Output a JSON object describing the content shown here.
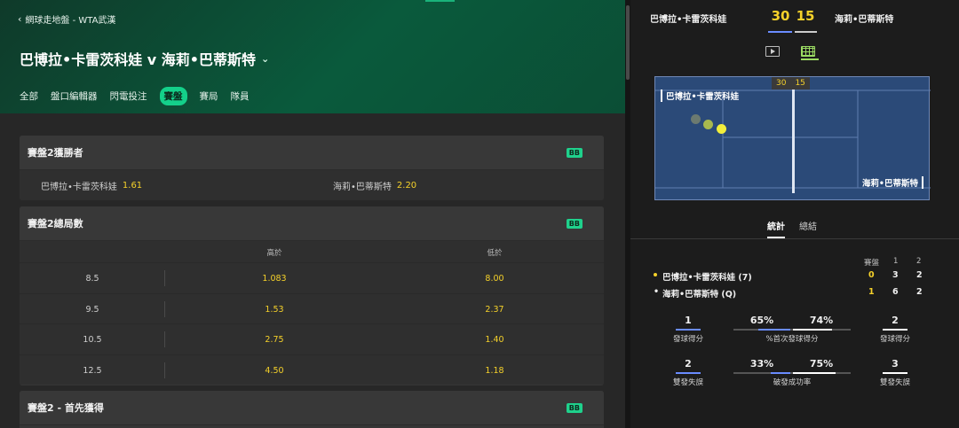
{
  "breadcrumb": {
    "back_label": "網球走地盤 - WTA武漢"
  },
  "match": {
    "title": "巴博拉•卡雷茨科娃 v 海莉•巴蒂斯特"
  },
  "nav_tabs": [
    "全部",
    "盤口編輯器",
    "閃電投注",
    "賽盤",
    "賽局",
    "隊員"
  ],
  "active_tab": "賽盤",
  "markets": [
    {
      "title": "賽盤2獲勝者",
      "badge": "BB",
      "selections": [
        {
          "name": "巴博拉•卡雷茨科娃",
          "odds": "1.61"
        },
        {
          "name": "海莉•巴蒂斯特",
          "odds": "2.20"
        }
      ]
    },
    {
      "title": "賽盤2總局數",
      "badge": "BB",
      "columns": [
        "高於",
        "低於"
      ],
      "rows": [
        {
          "line": "8.5",
          "over": "1.083",
          "under": "8.00"
        },
        {
          "line": "9.5",
          "over": "1.53",
          "under": "2.37"
        },
        {
          "line": "10.5",
          "over": "2.75",
          "under": "1.40"
        },
        {
          "line": "12.5",
          "over": "4.50",
          "under": "1.18"
        }
      ]
    },
    {
      "title": "賽盤2 - 首先獲得",
      "badge": "BB"
    }
  ],
  "scoreboard": {
    "player1": "巴博拉•卡雷茨科娃",
    "player2": "海莉•巴蒂斯特",
    "points1": "30",
    "points2": "15"
  },
  "court": {
    "score1": "30",
    "score2": "15",
    "player1": "巴博拉•卡雷茨科娃",
    "player2": "海莉•巴蒂斯特"
  },
  "stats_tabs": [
    "統計",
    "總結"
  ],
  "sets_table": {
    "headers": [
      "賽盤",
      "1",
      "2"
    ],
    "rows": [
      {
        "name": "巴博拉•卡雷茨科娃 (7)",
        "current": "0",
        "set1": "3",
        "set2": "2",
        "serving": true
      },
      {
        "name": "海莉•巴蒂斯特 (Q)",
        "current": "1",
        "set1": "6",
        "set2": "2",
        "serving": false
      }
    ]
  },
  "stats": [
    {
      "left": "1",
      "right": "2",
      "label_left": "發球得分",
      "label_right": "發球得分"
    },
    {
      "left_pct": "65%",
      "right_pct": "74%",
      "label": "%首次發球得分"
    },
    {
      "left": "2",
      "right": "3",
      "label_left": "雙發失誤",
      "label_right": "雙發失誤"
    },
    {
      "left_pct": "33%",
      "right_pct": "75%",
      "label": "破發成功率"
    }
  ],
  "colors": {
    "accent": "#14d08a",
    "odds": "#f5d12a",
    "p1": "#6a8cff",
    "p2": "#ffffff"
  }
}
